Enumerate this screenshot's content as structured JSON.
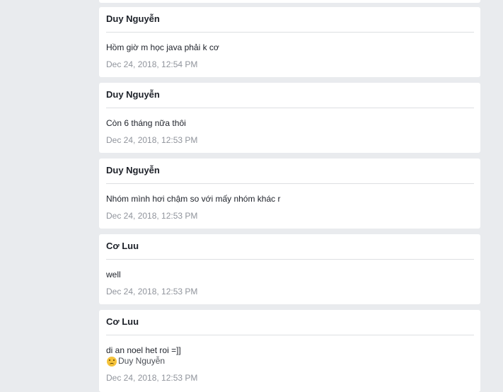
{
  "messages": [
    {
      "sender": "Duy Nguyễn",
      "text": "Hồm giờ m học java phải k cơ",
      "time": "Dec 24, 2018, 12:54 PM"
    },
    {
      "sender": "Duy Nguyễn",
      "text": "Còn 6 tháng nữa thôi",
      "time": "Dec 24, 2018, 12:53 PM"
    },
    {
      "sender": "Duy Nguyễn",
      "text": "Nhóm mình hơi chậm so với mấy nhóm khác r",
      "time": "Dec 24, 2018, 12:53 PM"
    },
    {
      "sender": "Cơ Luu",
      "text": "well",
      "time": "Dec 24, 2018, 12:53 PM"
    },
    {
      "sender": "Cơ Luu",
      "text": "di an noel het roi =]]",
      "mention": "Duy Nguyễn",
      "emoji": "sad-face-icon",
      "time": "Dec 24, 2018, 12:53 PM"
    }
  ]
}
